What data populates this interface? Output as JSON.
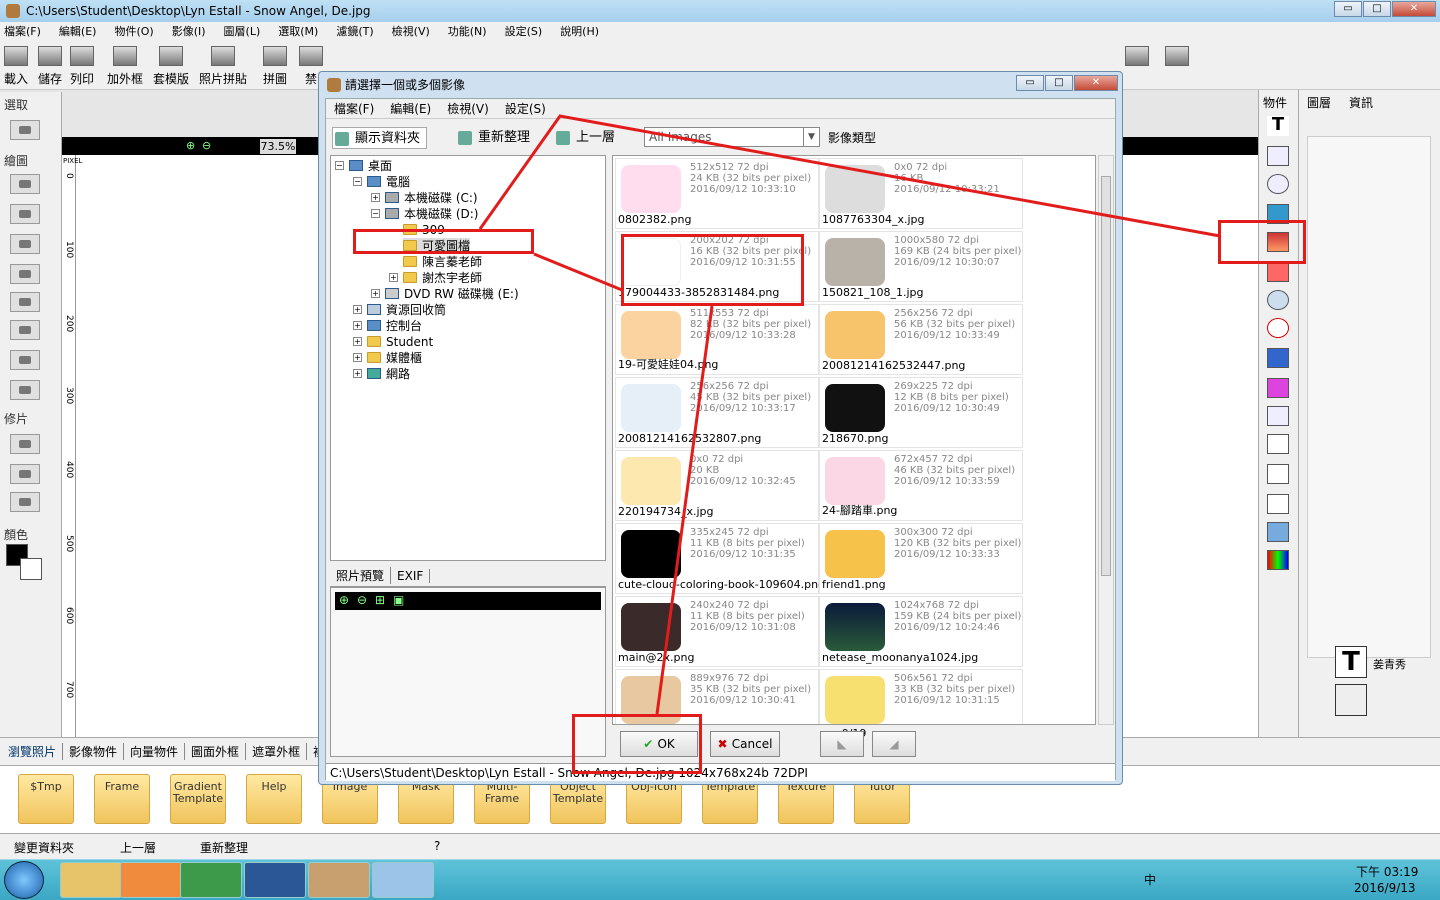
{
  "window": {
    "title": "C:\\Users\\Student\\Desktop\\Lyn Estall - Snow Angel, De.jpg",
    "btn_min": "▭",
    "btn_max": "□",
    "btn_close": "✕"
  },
  "menu": [
    "檔案(F)",
    "編輯(E)",
    "物件(O)",
    "影像(I)",
    "圖層(L)",
    "選取(M)",
    "濾鏡(T)",
    "檢視(V)",
    "功能(N)",
    "設定(S)",
    "說明(H)"
  ],
  "toolbar": [
    "載入",
    "儲存",
    "列印",
    "加外框",
    "套模版",
    "照片拼貼",
    "拼圖",
    "禁"
  ],
  "left_panel": {
    "select": "選取",
    "draw": "繪圖",
    "retouch": "修片",
    "color": "顏色"
  },
  "canvas": {
    "zoom": "73.5%",
    "ruler_unit": "PIXEL",
    "ruler_marks": [
      "0",
      "100",
      "200",
      "300",
      "400",
      "500",
      "600",
      "700"
    ]
  },
  "right_panel": {
    "label": "物件"
  },
  "layer_panel": {
    "tab_layers": "圖層",
    "tab_info": "資訊",
    "layer_name": "姜青秀"
  },
  "bottom_tabs": [
    "瀏覽照片",
    "影像物件",
    "向量物件",
    "圖面外框",
    "遮罩外框",
    "複"
  ],
  "folders": [
    "$Tmp",
    "Frame",
    "Gradient Template",
    "Help",
    "Image",
    "Mask",
    "Multi-Frame",
    "Object Template",
    "Obj-Icon",
    "Template",
    "Texture",
    "Tutor"
  ],
  "bottom_bar": {
    "change_folder": "變更資料夾",
    "up": "上一層",
    "refresh": "重新整理",
    "help": "?"
  },
  "tray": {
    "ime": "中",
    "time": "下午 03:19",
    "date": "2016/9/13"
  },
  "dialog": {
    "title": "請選擇一個或多個影像",
    "menu": [
      "檔案(F)",
      "編輯(E)",
      "檢視(V)",
      "設定(S)"
    ],
    "tools": {
      "show_folder": "顯示資料夾",
      "refresh": "重新整理",
      "up": "上一層",
      "path": "All Images",
      "type_label": "影像類型"
    },
    "tree": {
      "desktop": "桌面",
      "computer": "電腦",
      "drive_c": "本機磁碟 (C:)",
      "drive_d": "本機磁碟 (D:)",
      "folder_309": "309",
      "folder_cute": "可愛圖檔",
      "folder_chen": "陳言蓁老師",
      "folder_hsieh": "謝杰宇老師",
      "dvd": "DVD RW 磁碟機 (E:)",
      "recycle": "資源回收筒",
      "control": "控制台",
      "student": "Student",
      "media": "媒體櫃",
      "network": "網路"
    },
    "preview_tabs": {
      "preview": "照片預覽",
      "exif": "EXIF"
    },
    "files": [
      {
        "name": "0802382.png",
        "dims": "512x512 72 dpi",
        "size": "24 KB (32 bits per pixel)",
        "date": "2016/09/12 10:33:10"
      },
      {
        "name": "1087763304_x.jpg",
        "dims": "0x0 72 dpi",
        "size": "16 KB",
        "date": "2016/09/12 10:33:21"
      },
      {
        "name": "179004433-3852831484.png",
        "dims": "200x202 72 dpi",
        "size": "16 KB (32 bits per pixel)",
        "date": "2016/09/12 10:31:55"
      },
      {
        "name": "150821_108_1.jpg",
        "dims": "1000x580 72 dpi",
        "size": "169 KB (24 bits per pixel)",
        "date": "2016/09/12 10:30:07"
      },
      {
        "name": "19-可愛娃娃04.png",
        "dims": "511x553 72 dpi",
        "size": "82 KB (32 bits per pixel)",
        "date": "2016/09/12 10:33:28"
      },
      {
        "name": "20081214162532447.png",
        "dims": "256x256 72 dpi",
        "size": "56 KB (32 bits per pixel)",
        "date": "2016/09/12 10:33:49"
      },
      {
        "name": "20081214162532807.png",
        "dims": "256x256 72 dpi",
        "size": "45 KB (32 bits per pixel)",
        "date": "2016/09/12 10:33:17"
      },
      {
        "name": "218670.png",
        "dims": "269x225 72 dpi",
        "size": "12 KB (8 bits per pixel)",
        "date": "2016/09/12 10:30:49"
      },
      {
        "name": "220194734_x.jpg",
        "dims": "0x0 72 dpi",
        "size": "20 KB",
        "date": "2016/09/12 10:32:45"
      },
      {
        "name": "24-腳踏車.png",
        "dims": "672x457 72 dpi",
        "size": "46 KB (32 bits per pixel)",
        "date": "2016/09/12 10:33:59"
      },
      {
        "name": "cute-cloud-coloring-book-109604.png",
        "dims": "335x245 72 dpi",
        "size": "11 KB (8 bits per pixel)",
        "date": "2016/09/12 10:31:35"
      },
      {
        "name": "friend1.png",
        "dims": "300x300 72 dpi",
        "size": "120 KB (32 bits per pixel)",
        "date": "2016/09/12 10:33:33"
      },
      {
        "name": "main@2x.png",
        "dims": "240x240 72 dpi",
        "size": "11 KB (8 bits per pixel)",
        "date": "2016/09/12 10:31:08"
      },
      {
        "name": "netease_moonanya1024.jpg",
        "dims": "1024x768 72 dpi",
        "size": "159 KB (24 bits per pixel)",
        "date": "2016/09/12 10:24:46"
      },
      {
        "name": "",
        "dims": "889x976 72 dpi",
        "size": "35 KB (32 bits per pixel)",
        "date": "2016/09/12 10:30:41"
      },
      {
        "name": "",
        "dims": "506x561 72 dpi",
        "size": "33 KB (32 bits per pixel)",
        "date": "2016/09/12 10:31:15"
      }
    ],
    "count": "0/19",
    "ok": "OK",
    "cancel": "Cancel",
    "status": "C:\\Users\\Student\\Desktop\\Lyn Estall - Snow Angel, De.jpg    1024x768x24b    72DPI"
  },
  "colors": {
    "highlight": "#e21b1b"
  }
}
